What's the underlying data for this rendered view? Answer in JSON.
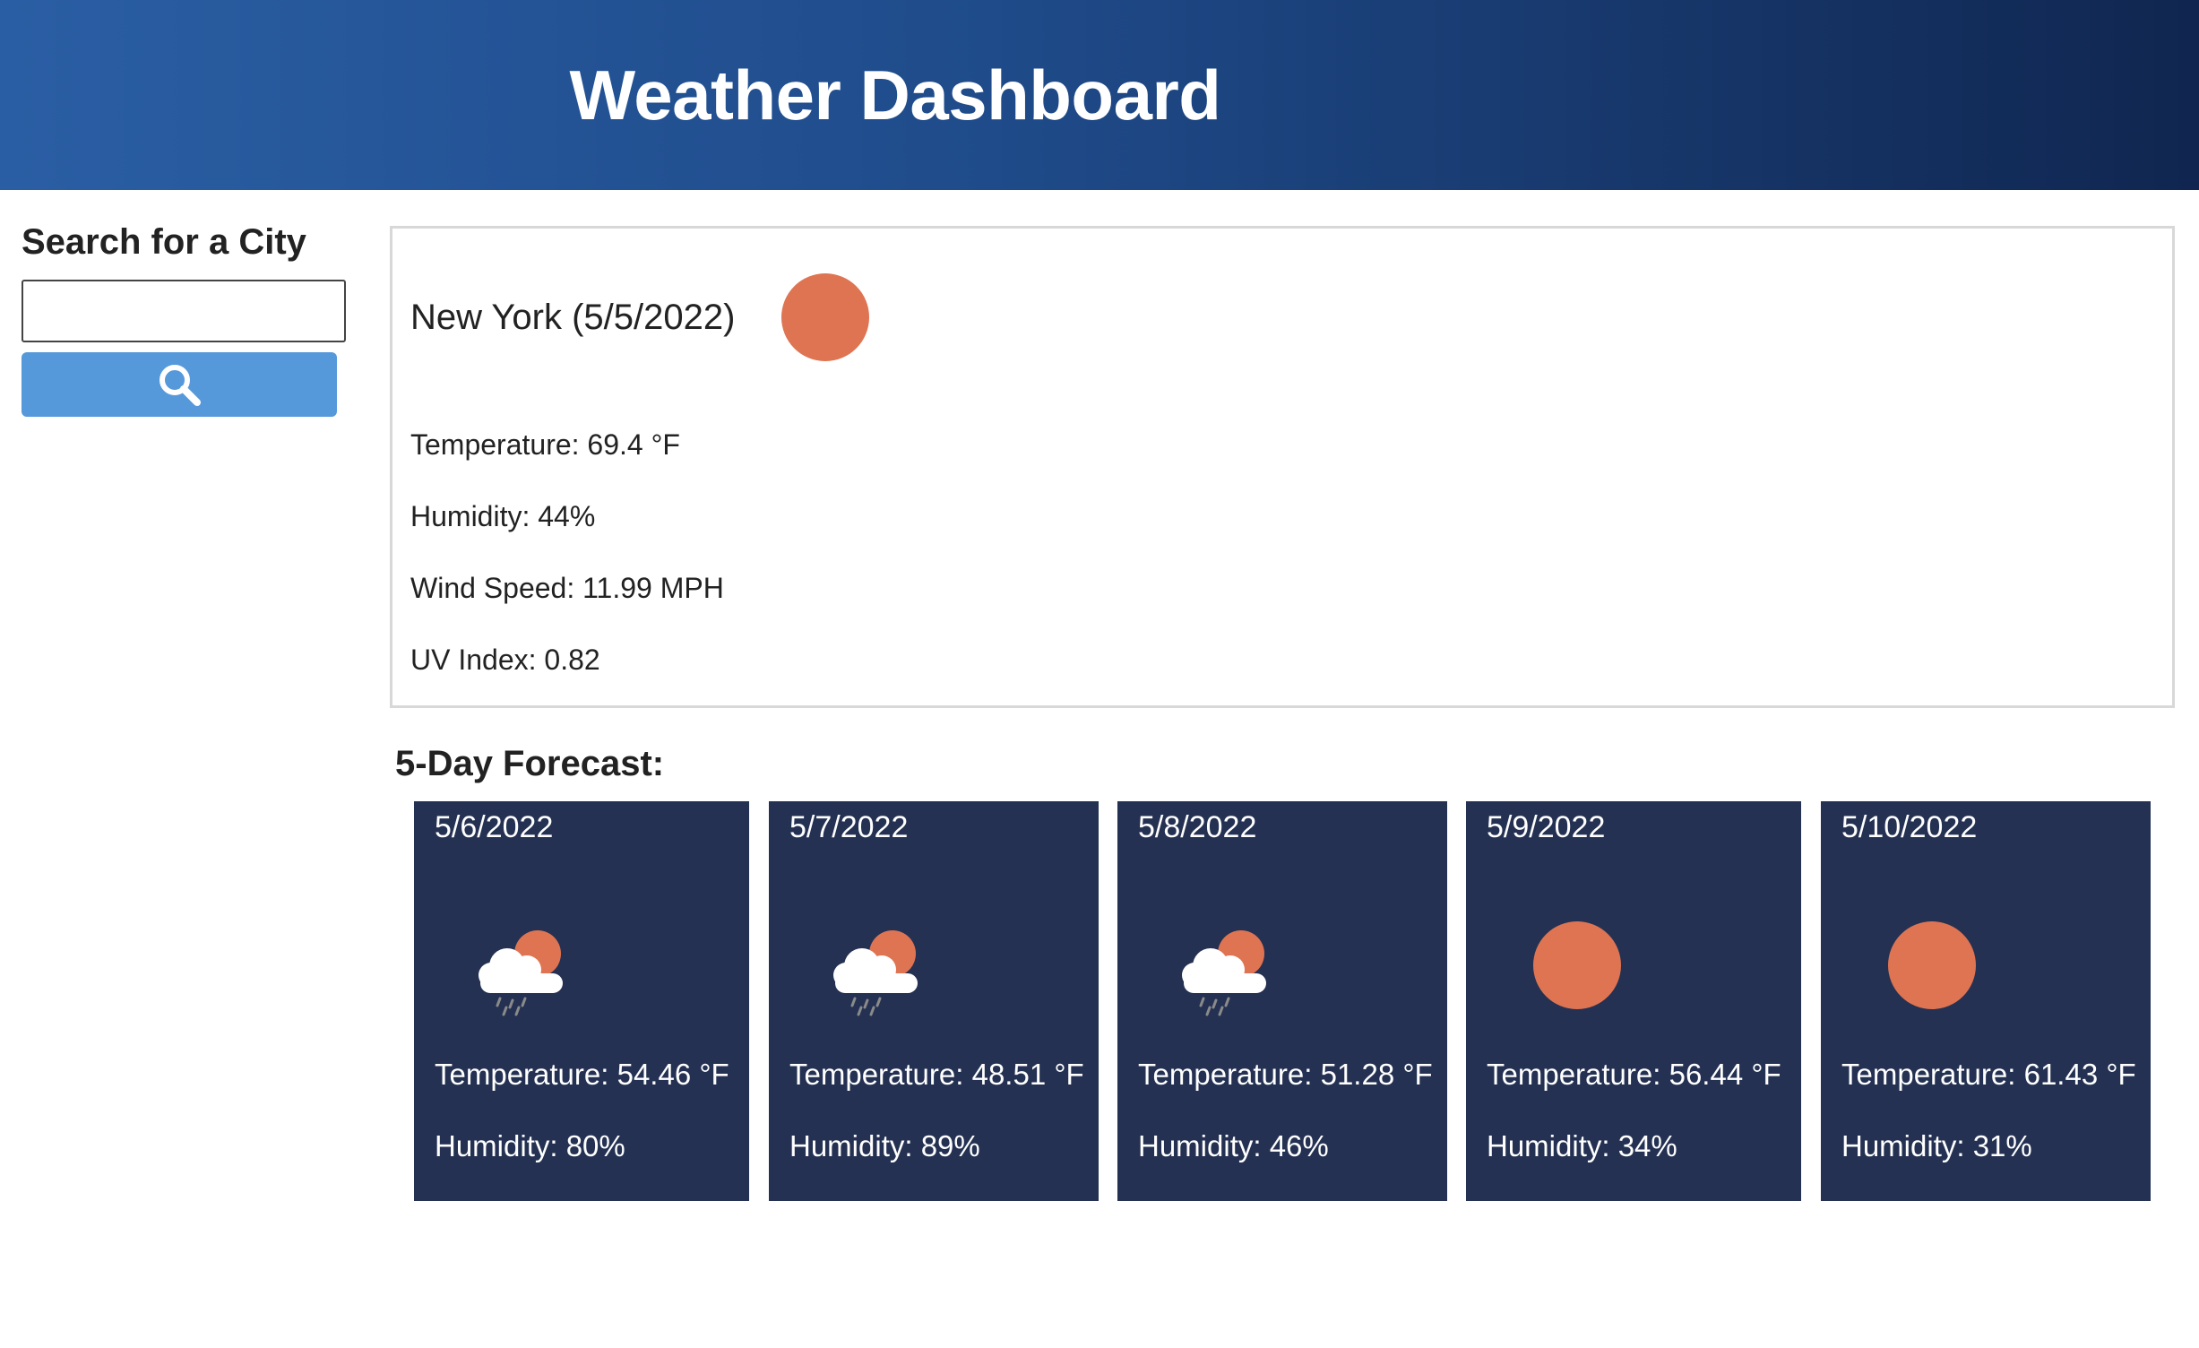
{
  "header": {
    "title": "Weather Dashboard"
  },
  "sidebar": {
    "title": "Search for a City",
    "search_value": "",
    "search_button_icon": "search-icon"
  },
  "current": {
    "title": "New York (5/5/2022)",
    "icon": "sun-icon",
    "temperature": "Temperature: 69.4 °F",
    "humidity": "Humidity: 44%",
    "wind": "Wind Speed: 11.99 MPH",
    "uv": "UV Index: 0.82"
  },
  "forecast": {
    "title": "5-Day Forecast:",
    "days": [
      {
        "date": "5/6/2022",
        "icon": "rain-cloud-sun-icon",
        "temperature": "Temperature: 54.46 °F",
        "humidity": "Humidity: 80%"
      },
      {
        "date": "5/7/2022",
        "icon": "rain-cloud-sun-icon",
        "temperature": "Temperature: 48.51 °F",
        "humidity": "Humidity: 89%"
      },
      {
        "date": "5/8/2022",
        "icon": "rain-cloud-sun-icon",
        "temperature": "Temperature: 51.28 °F",
        "humidity": "Humidity: 46%"
      },
      {
        "date": "5/9/2022",
        "icon": "sun-icon",
        "temperature": "Temperature: 56.44 °F",
        "humidity": "Humidity: 34%"
      },
      {
        "date": "5/10/2022",
        "icon": "sun-icon",
        "temperature": "Temperature: 61.43 °F",
        "humidity": "Humidity: 31%"
      }
    ]
  },
  "colors": {
    "header_start": "#2a5ea4",
    "header_end": "#102650",
    "button": "#5599db",
    "card": "#243152",
    "sun": "#de7452"
  }
}
